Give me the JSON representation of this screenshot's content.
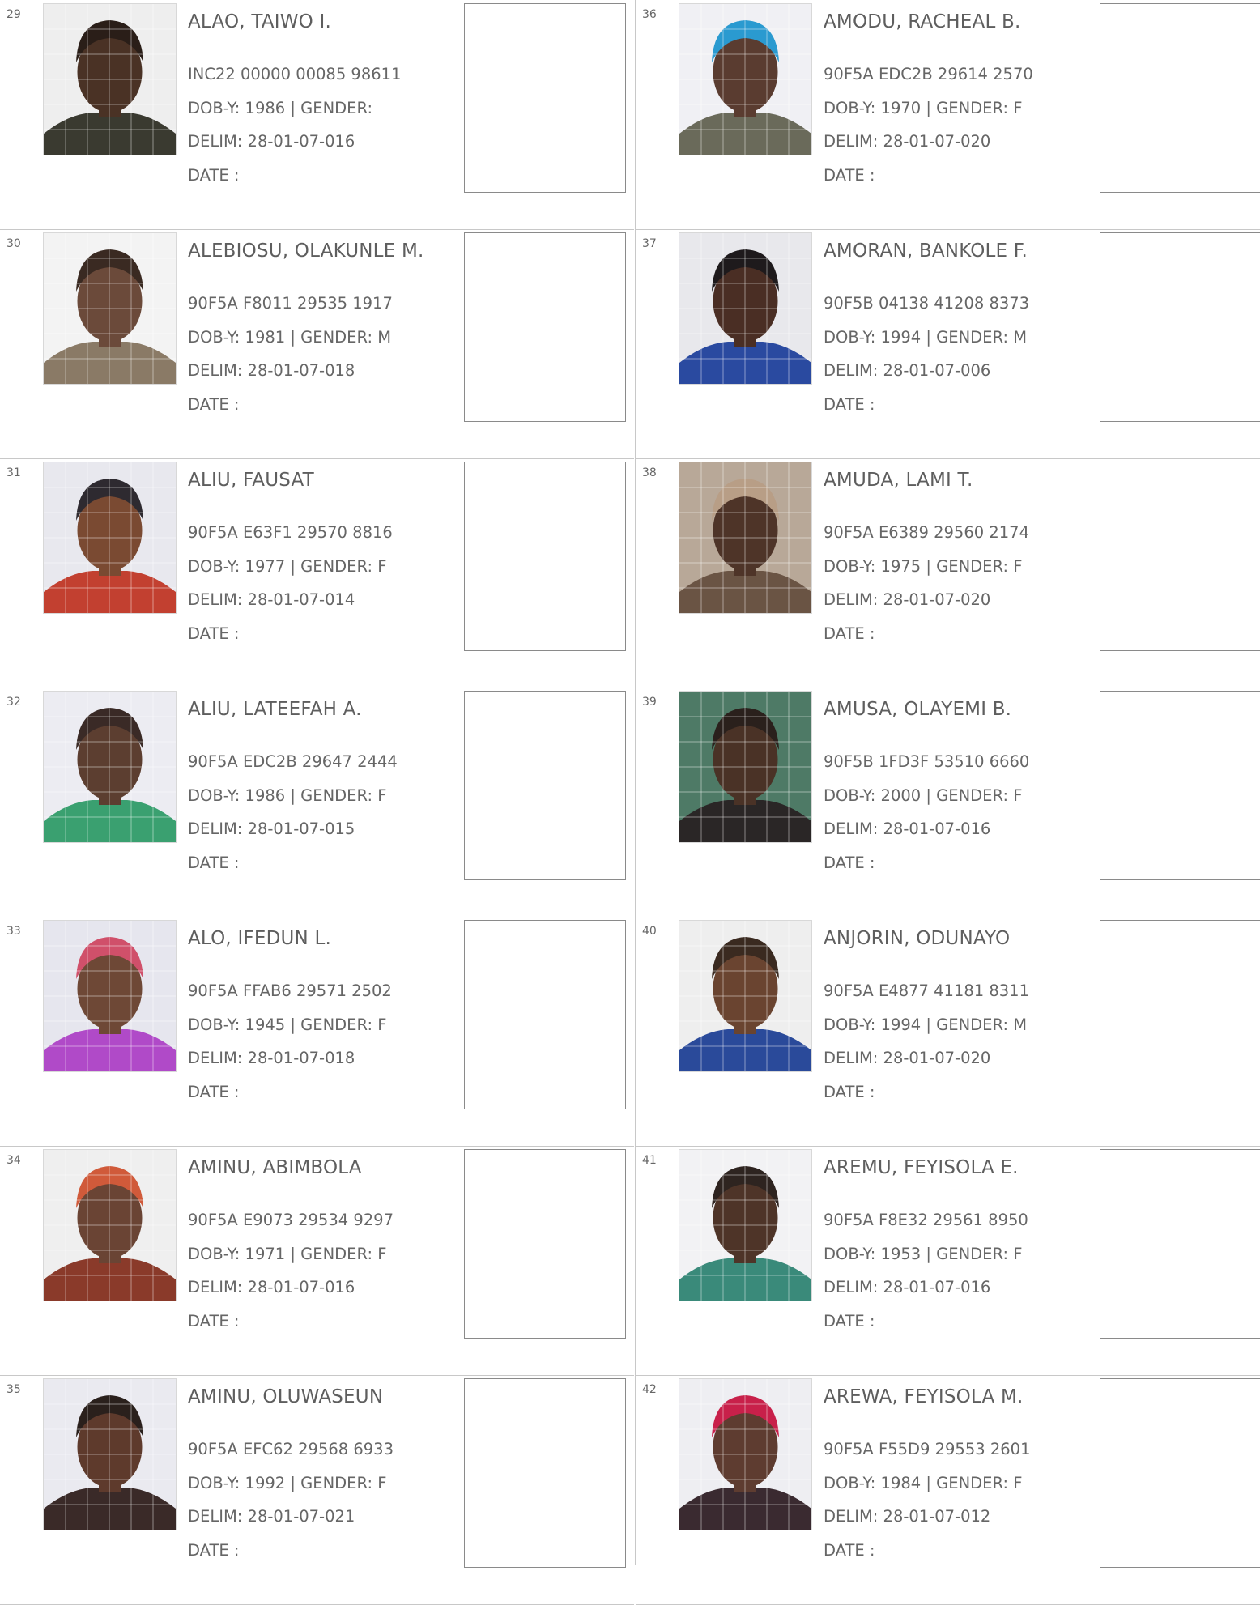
{
  "voters": [
    {
      "sn": "29",
      "name": "ALAO, TAIWO I.",
      "vin": "INC22 00000 00085 98611",
      "dob_gender": "DOB-Y: 1986  | GENDER: ",
      "delim": "DELIM: 28-01-07-016",
      "date": "DATE  :",
      "bg": "#eeeeee",
      "skin": "#4a3225",
      "head": "#2a1e18",
      "cloth": "#3a3a30"
    },
    {
      "sn": "30",
      "name": "ALEBIOSU, OLAKUNLE M.",
      "vin": "90F5A F8011 29535 1917",
      "dob_gender": "DOB-Y: 1981  | GENDER: M",
      "delim": "DELIM: 28-01-07-018",
      "date": "DATE  :",
      "bg": "#f3f3f3",
      "skin": "#6b4a3a",
      "head": "#3a2a22",
      "cloth": "#8a7a66"
    },
    {
      "sn": "31",
      "name": "ALIU, FAUSAT",
      "vin": "90F5A E63F1 29570 8816",
      "dob_gender": "DOB-Y: 1977  | GENDER: F",
      "delim": "DELIM: 28-01-07-014",
      "date": "DATE  :",
      "bg": "#e8e8ee",
      "skin": "#7a4a32",
      "head": "#2e2a30",
      "cloth": "#c24030"
    },
    {
      "sn": "32",
      "name": "ALIU, LATEEFAH A.",
      "vin": "90F5A EDC2B 29647 2444",
      "dob_gender": "DOB-Y: 1986  | GENDER: F",
      "delim": "DELIM: 28-01-07-015",
      "date": "DATE  :",
      "bg": "#ececf2",
      "skin": "#5c3e30",
      "head": "#3a2a26",
      "cloth": "#3aa070"
    },
    {
      "sn": "33",
      "name": "ALO, IFEDUN L.",
      "vin": "90F5A FFAB6 29571 2502",
      "dob_gender": "DOB-Y: 1945  | GENDER: F",
      "delim": "DELIM: 28-01-07-018",
      "date": "DATE  :",
      "bg": "#e6e6ee",
      "skin": "#6e4836",
      "head": "#d0506a",
      "cloth": "#b04ac8"
    },
    {
      "sn": "34",
      "name": "AMINU, ABIMBOLA",
      "vin": "90F5A E9073 29534 9297",
      "dob_gender": "DOB-Y: 1971  | GENDER: F",
      "delim": "DELIM: 28-01-07-016",
      "date": "DATE  :",
      "bg": "#efefef",
      "skin": "#6a4434",
      "head": "#d05a3a",
      "cloth": "#8a3a2a"
    },
    {
      "sn": "35",
      "name": "AMINU, OLUWASEUN",
      "vin": "90F5A EFC62 29568 6933",
      "dob_gender": "DOB-Y: 1992  | GENDER: F",
      "delim": "DELIM: 28-01-07-021",
      "date": "DATE  :",
      "bg": "#eaeaf0",
      "skin": "#5e3a2c",
      "head": "#2a201c",
      "cloth": "#3a2a28"
    },
    {
      "sn": "36",
      "name": "AMODU, RACHEAL B.",
      "vin": "90F5A EDC2B 29614 2570",
      "dob_gender": "DOB-Y: 1970  | GENDER: F",
      "delim": "DELIM: 28-01-07-020",
      "date": "DATE  :",
      "bg": "#f0f0f4",
      "skin": "#5a3c30",
      "head": "#2a9ad0",
      "cloth": "#6a6a5a"
    },
    {
      "sn": "37",
      "name": "AMORAN, BANKOLE F.",
      "vin": "90F5B 04138 41208 8373",
      "dob_gender": "DOB-Y: 1994  | GENDER: M",
      "delim": "DELIM: 28-01-07-006",
      "date": "DATE  :",
      "bg": "#e8e8ec",
      "skin": "#4a2e24",
      "head": "#1e1a1c",
      "cloth": "#2a4aa0"
    },
    {
      "sn": "38",
      "name": "AMUDA, LAMI T.",
      "vin": "90F5A E6389 29560 2174",
      "dob_gender": "DOB-Y: 1975  | GENDER: F",
      "delim": "DELIM: 28-01-07-020",
      "date": "DATE  :",
      "bg": "#b8a898",
      "skin": "#4e3428",
      "head": "#b89e86",
      "cloth": "#6a5444"
    },
    {
      "sn": "39",
      "name": "AMUSA, OLAYEMI B.",
      "vin": "90F5B 1FD3F 53510 6660",
      "dob_gender": "DOB-Y: 2000  | GENDER: F",
      "delim": "DELIM: 28-01-07-016",
      "date": "DATE  :",
      "bg": "#4e7a66",
      "skin": "#4a3226",
      "head": "#2a201c",
      "cloth": "#2a2626"
    },
    {
      "sn": "40",
      "name": "ANJORIN, ODUNAYO",
      "vin": "90F5A E4877 41181 8311",
      "dob_gender": "DOB-Y: 1994  | GENDER: M",
      "delim": "DELIM: 28-01-07-020",
      "date": "DATE  :",
      "bg": "#eeeeee",
      "skin": "#6a4430",
      "head": "#3a2a20",
      "cloth": "#2a4a9a"
    },
    {
      "sn": "41",
      "name": "AREMU, FEYISOLA E.",
      "vin": "90F5A F8E32 29561 8950",
      "dob_gender": "DOB-Y: 1953  | GENDER: F",
      "delim": "DELIM: 28-01-07-016",
      "date": "DATE  :",
      "bg": "#f2f2f4",
      "skin": "#4e3428",
      "head": "#2e2420",
      "cloth": "#3a8a7a"
    },
    {
      "sn": "42",
      "name": "AREWA, FEYISOLA M.",
      "vin": "90F5A F55D9 29553 2601",
      "dob_gender": "DOB-Y: 1984  | GENDER: F",
      "delim": "DELIM: 28-01-07-012",
      "date": "DATE  :",
      "bg": "#eeeef2",
      "skin": "#5e3c30",
      "head": "#c8204a",
      "cloth": "#3a2a30"
    }
  ]
}
